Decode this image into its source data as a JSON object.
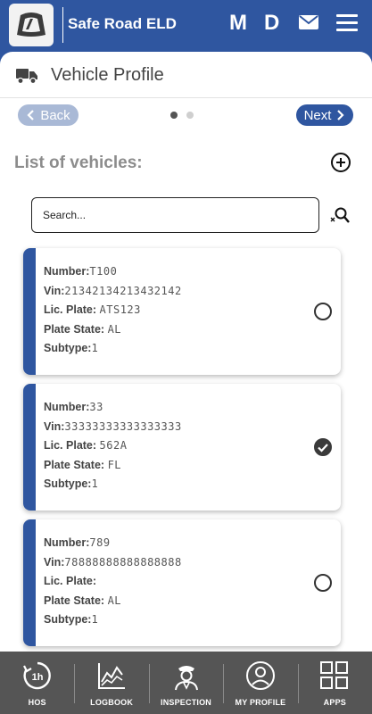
{
  "app": {
    "title": "Safe Road ELD",
    "letters": [
      "M",
      "D"
    ]
  },
  "page": {
    "title": "Vehicle Profile",
    "back_label": "Back",
    "next_label": "Next"
  },
  "list": {
    "title": "List of vehicles:"
  },
  "search": {
    "placeholder": "Search..."
  },
  "field_labels": {
    "number": "Number:",
    "vin": "Vin:",
    "plate": "Lic. Plate:",
    "state": "Plate State:",
    "subtype": "Subtype:"
  },
  "vehicles": [
    {
      "number": "T100",
      "vin": "21342134213432142",
      "plate": "ATS123",
      "state": "AL",
      "subtype": "1",
      "selected": false
    },
    {
      "number": "33",
      "vin": "33333333333333333",
      "plate": "562A",
      "state": "FL",
      "subtype": "1",
      "selected": true
    },
    {
      "number": "789",
      "vin": "78888888888888888",
      "plate": "",
      "state": "AL",
      "subtype": "1",
      "selected": false
    }
  ],
  "nav": [
    {
      "label": "HOS",
      "icon": "hos-clock-icon"
    },
    {
      "label": "LOGBOOK",
      "icon": "logbook-chart-icon"
    },
    {
      "label": "INSPECTION",
      "icon": "inspector-icon"
    },
    {
      "label": "MY PROFILE",
      "icon": "profile-icon"
    },
    {
      "label": "APPS",
      "icon": "apps-grid-icon"
    }
  ],
  "colors": {
    "primary": "#2f56a0",
    "nav_bg": "#555555",
    "back_button": "#a9b9d6"
  }
}
